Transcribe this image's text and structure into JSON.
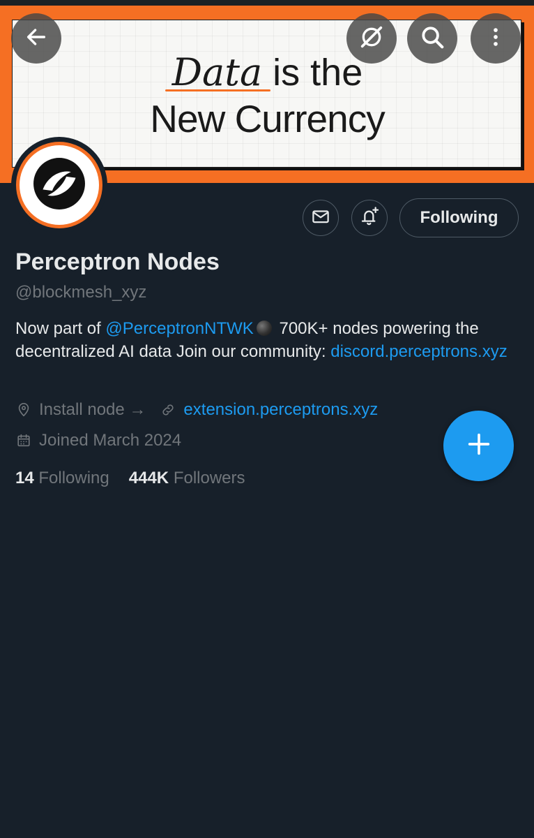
{
  "banner": {
    "line1_em": "Data",
    "line1_rest": " is the",
    "line2": "New Currency"
  },
  "toolbar": {
    "back_icon": "arrow-left-icon",
    "grok_icon": "grok-slash-icon",
    "search_icon": "search-icon",
    "more_icon": "more-vertical-icon"
  },
  "profile": {
    "name": "Perceptron Nodes",
    "handle": "@blockmesh_xyz",
    "bio_prefix": "Now part of ",
    "bio_mention": "@PerceptronNTWK",
    "bio_middle": " 700K+ nodes powering the decentralized AI data Join our community: ",
    "bio_link": "discord.perceptrons.xyz",
    "location": "Install node →",
    "website": "extension.perceptrons.xyz",
    "joined": "Joined March 2024",
    "following_count": "14",
    "following_label": "Following",
    "followers_count": "444K",
    "followers_label": "Followers"
  },
  "actions": {
    "message_icon": "mail-icon",
    "notify_icon": "bell-plus-icon",
    "following_button": "Following",
    "compose_icon": "plus-icon"
  },
  "colors": {
    "background": "#17202a",
    "accent": "#1d9bf0",
    "banner_orange": "#f56f23",
    "muted_text": "#71767b"
  }
}
